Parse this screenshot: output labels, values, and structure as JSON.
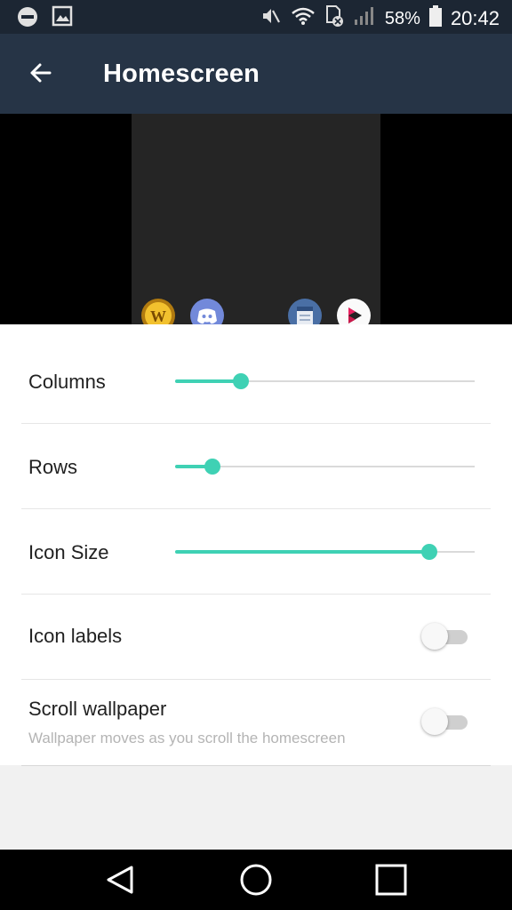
{
  "status_bar": {
    "battery": "58%",
    "time": "20:42",
    "left_icons": [
      "do-not-disturb-icon",
      "image-notification-icon"
    ],
    "right_icons": [
      "mute-icon",
      "wifi-icon",
      "no-sim-icon",
      "signal-icon",
      "battery-icon"
    ]
  },
  "app_bar": {
    "title": "Homescreen",
    "back_icon": "arrow-left-icon"
  },
  "preview": {
    "dock_icons": [
      "wow-app-icon",
      "discord-app-icon",
      "notes-app-icon",
      "media-app-icon"
    ]
  },
  "settings": [
    {
      "label": "Columns",
      "type": "slider",
      "value": 0.22
    },
    {
      "label": "Rows",
      "type": "slider",
      "value": 0.125
    },
    {
      "label": "Icon Size",
      "type": "slider",
      "value": 0.85
    },
    {
      "label": "Icon labels",
      "type": "toggle",
      "checked": false
    },
    {
      "label": "Scroll wallpaper",
      "type": "toggle",
      "checked": false,
      "subtitle": "Wallpaper moves as you scroll the homescreen"
    }
  ],
  "colors": {
    "accent": "#3fd1b4",
    "app_bar": "#263446",
    "status_bar": "#1c2633"
  },
  "nav_bar": {
    "icons": [
      "back-triangle-icon",
      "home-circle-icon",
      "recents-square-icon"
    ]
  }
}
